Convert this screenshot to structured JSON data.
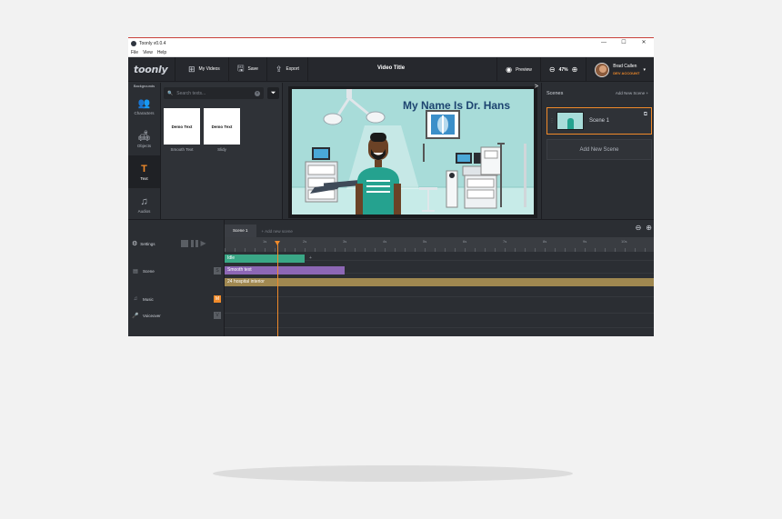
{
  "window": {
    "title": "Toonly v0.0.4",
    "controls": [
      "—",
      "☐",
      "✕"
    ]
  },
  "menu": [
    "File",
    "View",
    "Help"
  ],
  "toolbar": {
    "logo": "toonly",
    "my_videos": "My Videos",
    "save": "Save",
    "export": "Export",
    "video_title": "Video Title",
    "preview": "Preview",
    "zoom": "47%",
    "user_name": "Brad Callen",
    "user_role": "DEV ACCOUNT"
  },
  "categories": {
    "header": "Backgrounds",
    "items": [
      {
        "label": "Characters",
        "icon": "👥"
      },
      {
        "label": "Objects",
        "icon": "🛋"
      },
      {
        "label": "Text",
        "icon": "T"
      },
      {
        "label": "Audios",
        "icon": "♫"
      }
    ]
  },
  "library": {
    "search_placeholder": "Search texts...",
    "items": [
      {
        "preview": "Demo Text",
        "label": "Smooth Text"
      },
      {
        "preview": "Demo Text",
        "label": "Slidy"
      }
    ]
  },
  "canvas": {
    "scene_title": "My Name Is Dr. Hans",
    "collapse": ">"
  },
  "scenes": {
    "header": "Scenes",
    "add_link": "Add New Scene",
    "items": [
      {
        "name": "Scene 1"
      }
    ],
    "add_button": "Add New Scene"
  },
  "timeline": {
    "tabs": [
      "Scene 1"
    ],
    "add_tab": "Add new scene",
    "ruler": [
      "1s",
      "2s",
      "3s",
      "4s",
      "5s",
      "6s",
      "7s",
      "8s",
      "9s",
      "10s"
    ],
    "settings_label": "Settings",
    "tracks": {
      "scene": "Scene",
      "music": "Music",
      "music_badge": "M",
      "voiceover": "Voiceover",
      "scene_badge": "S",
      "vo_badge": "V"
    },
    "clips": [
      {
        "label": "Idle",
        "color": "#3aa786"
      },
      {
        "label": "Smooth text",
        "color": "#8d67b5"
      },
      {
        "label": "24 hospital interior",
        "color": "#a08850"
      }
    ]
  },
  "colors": {
    "accent": "#f08a2a",
    "scene_bg": "#a8dcd9",
    "title_blue": "#1d4470"
  }
}
